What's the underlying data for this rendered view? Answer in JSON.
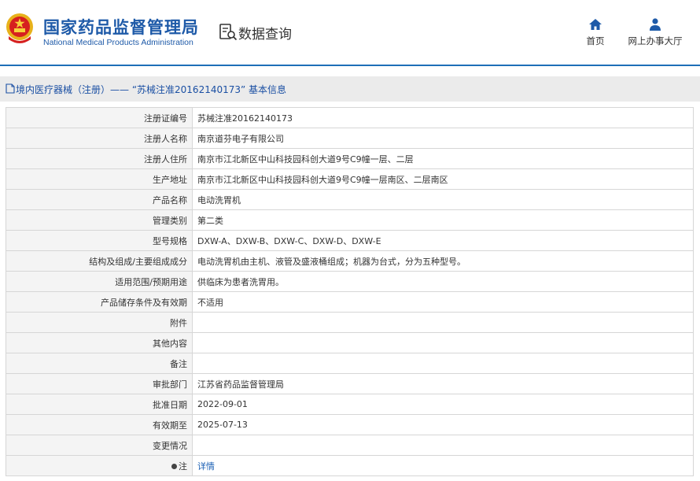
{
  "header": {
    "logo_cn": "国家药品监督管理局",
    "logo_en": "National Medical Products Administration",
    "section_title": "数据查询",
    "nav": [
      {
        "label": "首页",
        "icon": "home-icon"
      },
      {
        "label": "网上办事大厅",
        "icon": "user-icon"
      }
    ]
  },
  "breadcrumb": {
    "text": "境内医疗器械（注册）——  “苏械注准20162140173”  基本信息",
    "icon": "document-icon"
  },
  "rows": [
    {
      "label": "注册证编号",
      "value": "苏械注准20162140173"
    },
    {
      "label": "注册人名称",
      "value": "南京道芬电子有限公司"
    },
    {
      "label": "注册人住所",
      "value": "南京市江北新区中山科技园科创大道9号C9幢一层、二层"
    },
    {
      "label": "生产地址",
      "value": "南京市江北新区中山科技园科创大道9号C9幢一层南区、二层南区"
    },
    {
      "label": "产品名称",
      "value": "电动洗胃机"
    },
    {
      "label": "管理类别",
      "value": "第二类"
    },
    {
      "label": "型号规格",
      "value": "DXW-A、DXW-B、DXW-C、DXW-D、DXW-E"
    },
    {
      "label": "结构及组成/主要组成成分",
      "value": "电动洗胃机由主机、液管及盛液桶组成；机器为台式，分为五种型号。"
    },
    {
      "label": "适用范围/预期用途",
      "value": "供临床为患者洗胃用。"
    },
    {
      "label": "产品储存条件及有效期",
      "value": "不适用"
    },
    {
      "label": "附件",
      "value": ""
    },
    {
      "label": "其他内容",
      "value": ""
    },
    {
      "label": "备注",
      "value": ""
    },
    {
      "label": "审批部门",
      "value": "江苏省药品监督管理局"
    },
    {
      "label": "批准日期",
      "value": "2022-09-01"
    },
    {
      "label": "有效期至",
      "value": "2025-07-13"
    },
    {
      "label": "变更情况",
      "value": ""
    }
  ],
  "note_row": {
    "label": "注",
    "link": "详情"
  },
  "colors": {
    "brand_blue": "#1e5aa8",
    "link_blue": "#1a5fb4",
    "label_bg": "#f4f4f4",
    "crumb_bg": "#ebebeb"
  }
}
